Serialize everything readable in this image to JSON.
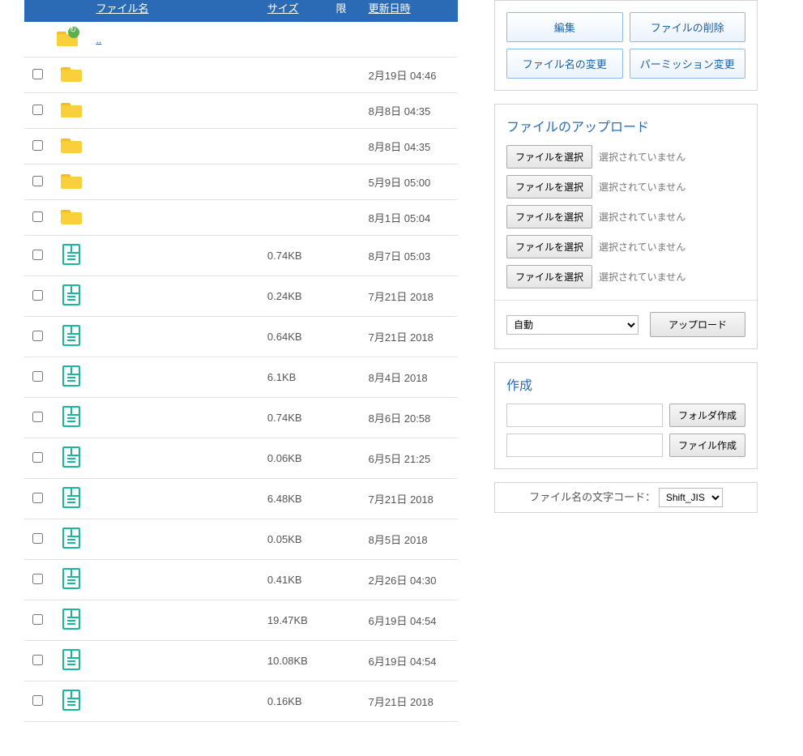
{
  "table": {
    "headers": {
      "filename": "ファイル名",
      "size": "サイズ",
      "perm": "限",
      "date": "更新日時"
    },
    "parent_link": "..",
    "rows": [
      {
        "type": "folder",
        "size": "",
        "date": "2月19日 04:46"
      },
      {
        "type": "folder",
        "size": "",
        "date": "8月8日 04:35"
      },
      {
        "type": "folder",
        "size": "",
        "date": "8月8日 04:35"
      },
      {
        "type": "folder",
        "size": "",
        "date": "5月9日 05:00"
      },
      {
        "type": "folder",
        "size": "",
        "date": "8月1日 05:04"
      },
      {
        "type": "file",
        "size": "0.74KB",
        "date": "8月7日 05:03"
      },
      {
        "type": "file",
        "size": "0.24KB",
        "date": "7月21日 2018"
      },
      {
        "type": "file",
        "size": "0.64KB",
        "date": "7月21日 2018"
      },
      {
        "type": "file",
        "size": "6.1KB",
        "date": "8月4日 2018"
      },
      {
        "type": "file",
        "size": "0.74KB",
        "date": "8月6日 20:58"
      },
      {
        "type": "file",
        "size": "0.06KB",
        "date": "6月5日 21:25"
      },
      {
        "type": "file",
        "size": "6.48KB",
        "date": "7月21日 2018"
      },
      {
        "type": "file",
        "size": "0.05KB",
        "date": "8月5日 2018"
      },
      {
        "type": "file",
        "size": "0.41KB",
        "date": "2月26日 04:30"
      },
      {
        "type": "file",
        "size": "19.47KB",
        "date": "6月19日 04:54"
      },
      {
        "type": "file",
        "size": "10.08KB",
        "date": "6月19日 04:54"
      },
      {
        "type": "file",
        "size": "0.16KB",
        "date": "7月21日 2018"
      }
    ]
  },
  "actions": {
    "edit": "編集",
    "delete": "ファイルの削除",
    "rename": "ファイル名の変更",
    "chmod": "パーミッション変更"
  },
  "upload": {
    "title": "ファイルのアップロード",
    "choose": "ファイルを選択",
    "no_file": "選択されていません",
    "encoding_label": "自動",
    "upload_btn": "アップロード"
  },
  "create": {
    "title": "作成",
    "mkdir": "フォルダ作成",
    "mkfile": "ファイル作成"
  },
  "code": {
    "label": "ファイル名の文字コード：",
    "value": "Shift_JIS"
  }
}
